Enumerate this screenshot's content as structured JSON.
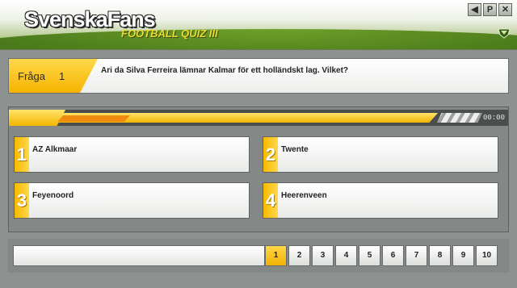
{
  "header": {
    "brand": "SvenskaFans",
    "subtitle": "FOOTBALL QUIZ III",
    "window_buttons": [
      {
        "icon": "sound-icon",
        "glyph": "◀"
      },
      {
        "icon": "pause-icon",
        "glyph": "P"
      },
      {
        "icon": "close-icon",
        "glyph": "✕"
      }
    ]
  },
  "question": {
    "label": "Fråga",
    "number": "1",
    "text": "Ari da Silva Ferreira lämnar Kalmar för ett holländskt lag. Vilket?"
  },
  "timer": {
    "display": "00:00",
    "remaining_fraction": 0.86
  },
  "answers": [
    {
      "number": "1",
      "text": "AZ Alkmaar"
    },
    {
      "number": "2",
      "text": "Twente"
    },
    {
      "number": "3",
      "text": "Feyenoord"
    },
    {
      "number": "4",
      "text": "Heerenveen"
    }
  ],
  "navigation": {
    "current": "1",
    "questions": [
      "1",
      "2",
      "3",
      "4",
      "5",
      "6",
      "7",
      "8",
      "9",
      "10"
    ]
  },
  "colors": {
    "accent": "#f5b400",
    "timer_accent": "#f08a10",
    "header_green": "#4f7f1c",
    "panel_gray": "#848987"
  }
}
